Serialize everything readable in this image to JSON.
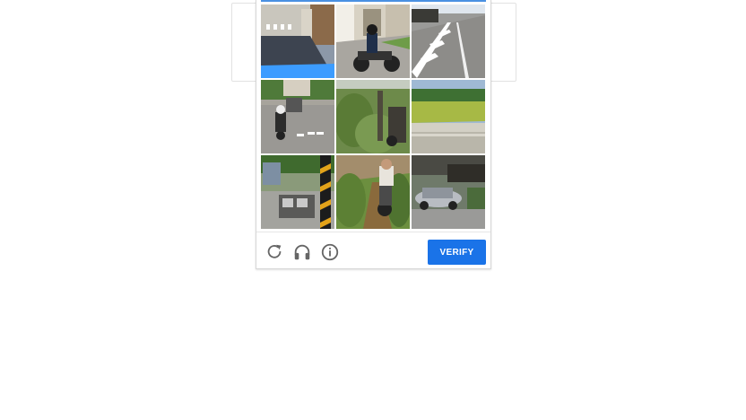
{
  "captcha": {
    "accent_color": "#1a73e8",
    "verify_label": "VERIFY",
    "icons": [
      "reload-icon",
      "headphones-icon",
      "info-icon"
    ],
    "tiles": [
      "street-with-blue-crosswalk",
      "motorcyclist-near-houses",
      "road-with-crosswalk",
      "motorcyclist-on-village-road",
      "bushes-and-parked-scooter",
      "green-field-and-water",
      "motorcycle-sidecar-and-pole",
      "cyclist-on-dirt-path",
      "parked-car-on-street"
    ]
  }
}
